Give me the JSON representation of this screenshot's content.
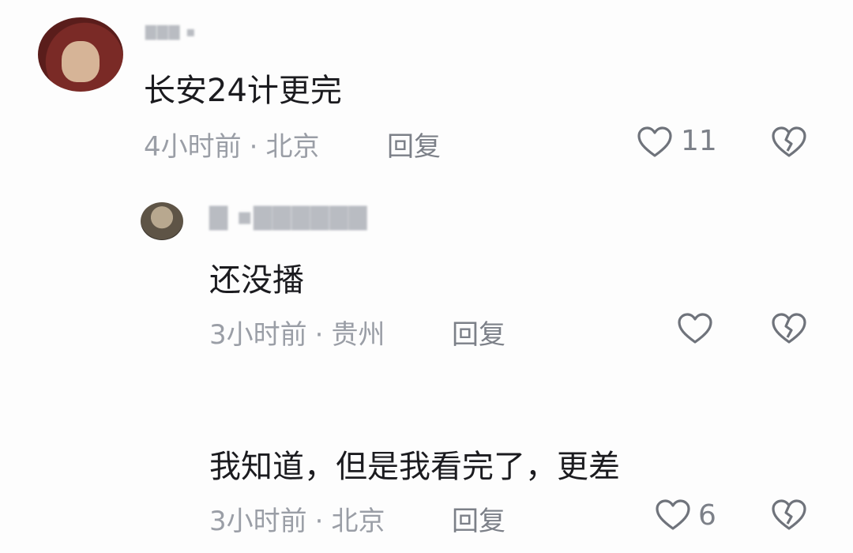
{
  "comments": [
    {
      "text": "长安24计更完",
      "time": "4小时前",
      "location": "北京",
      "reply_label": "回复",
      "likes": "11"
    },
    {
      "text": "还没播",
      "time": "3小时前",
      "location": "贵州",
      "reply_label": "回复",
      "likes": ""
    },
    {
      "text": "我知道，但是我看完了，更差",
      "time": "3小时前",
      "location": "北京",
      "reply_label": "回复",
      "likes": "6"
    }
  ],
  "separator": "·",
  "colors": {
    "text": "#1b1b1f",
    "meta": "#9a9ea6",
    "icon": "#6f737b"
  }
}
